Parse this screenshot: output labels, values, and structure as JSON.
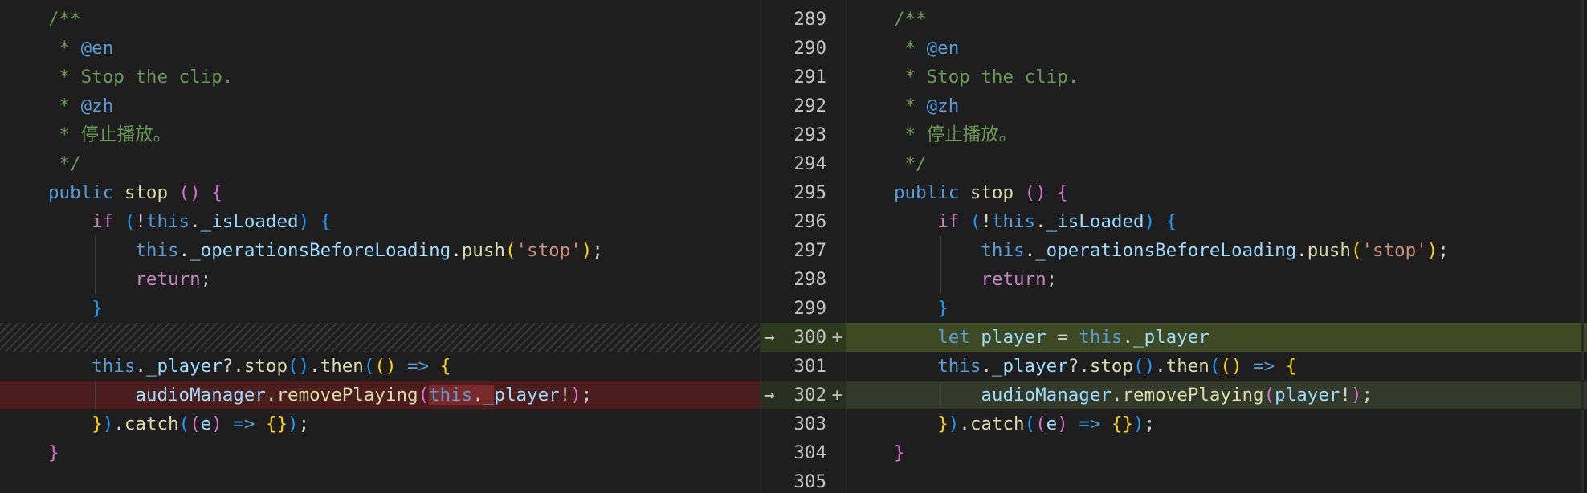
{
  "diff": {
    "left": {
      "lines": [
        [
          "/**"
        ],
        [
          " * ",
          "@en"
        ],
        [
          " * Stop the clip."
        ],
        [
          " * ",
          "@zh"
        ],
        [
          " * 停止播放。"
        ],
        [
          " */"
        ],
        [
          "public",
          " ",
          "stop",
          " ",
          "()",
          " ",
          "{"
        ],
        [
          "    ",
          "if",
          " ",
          "(",
          "!",
          "this",
          ".",
          "_isLoaded",
          ")",
          " ",
          "{"
        ],
        [
          "        ",
          "this",
          ".",
          "_operationsBeforeLoading",
          ".",
          "push",
          "(",
          "'stop'",
          ")",
          ";"
        ],
        [
          "        ",
          "return",
          ";"
        ],
        [
          "    ",
          "}"
        ],
        [],
        [
          "    ",
          "this",
          ".",
          "_player",
          "?.",
          "stop",
          "()",
          ".",
          "then",
          "(",
          "()",
          " ",
          "=>",
          " ",
          "{"
        ],
        [
          "        ",
          "audioManager",
          ".",
          "removePlaying",
          "(",
          "this",
          ".",
          "_",
          "player",
          "!",
          ")",
          ";"
        ],
        [
          "    ",
          "}",
          ")",
          ".",
          "catch",
          "(",
          "(",
          "e",
          ")",
          " ",
          "=>",
          " ",
          "{}",
          ")",
          ";"
        ],
        [
          "}"
        ]
      ]
    },
    "right": {
      "line_numbers": [
        "289",
        "290",
        "291",
        "292",
        "293",
        "294",
        "295",
        "296",
        "297",
        "298",
        "299",
        "300",
        "301",
        "302",
        "303",
        "304",
        "305"
      ],
      "added_marker": "+",
      "lines": [
        [
          "/**"
        ],
        [
          " * ",
          "@en"
        ],
        [
          " * Stop the clip."
        ],
        [
          " * ",
          "@zh"
        ],
        [
          " * 停止播放。"
        ],
        [
          " */"
        ],
        [
          "public",
          " ",
          "stop",
          " ",
          "()",
          " ",
          "{"
        ],
        [
          "    ",
          "if",
          " ",
          "(",
          "!",
          "this",
          ".",
          "_isLoaded",
          ")",
          " ",
          "{"
        ],
        [
          "        ",
          "this",
          ".",
          "_operationsBeforeLoading",
          ".",
          "push",
          "(",
          "'stop'",
          ")",
          ";"
        ],
        [
          "        ",
          "return",
          ";"
        ],
        [
          "    ",
          "}"
        ],
        [
          "    ",
          "let",
          " ",
          "player",
          " ",
          "=",
          " ",
          "this",
          ".",
          "_player"
        ],
        [
          "    ",
          "this",
          ".",
          "_player",
          "?.",
          "stop",
          "()",
          ".",
          "then",
          "(",
          "()",
          " ",
          "=>",
          " ",
          "{"
        ],
        [
          "        ",
          "audioManager",
          ".",
          "removePlaying",
          "(",
          "player",
          "!",
          ")",
          ";"
        ],
        [
          "    ",
          "}",
          ")",
          ".",
          "catch",
          "(",
          "(",
          "e",
          ")",
          " ",
          "=>",
          " ",
          "{}",
          ")",
          ";"
        ],
        [
          "}"
        ],
        []
      ]
    }
  },
  "icons": {
    "arrow": "arrow-right-icon"
  }
}
